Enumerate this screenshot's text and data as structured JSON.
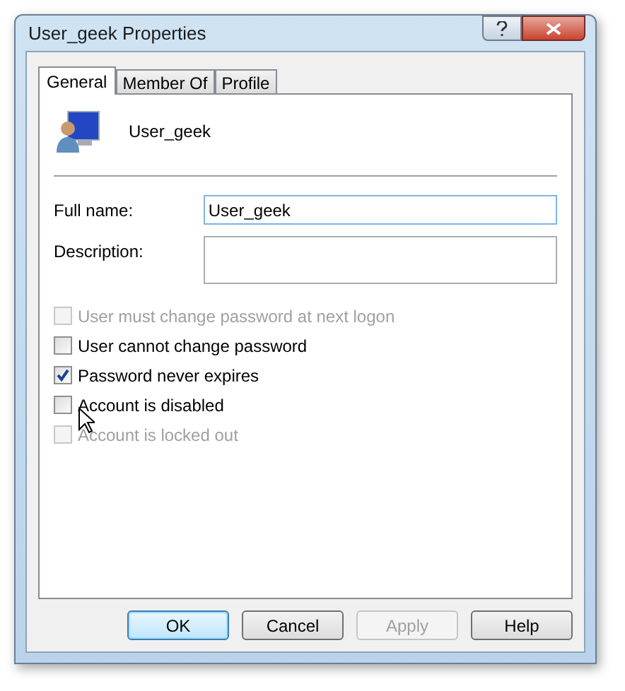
{
  "window": {
    "title": "User_geek Properties"
  },
  "tabs": [
    {
      "label": "General",
      "selected": true
    },
    {
      "label": "Member Of",
      "selected": false
    },
    {
      "label": "Profile",
      "selected": false
    }
  ],
  "user": {
    "name": "User_geek"
  },
  "fields": [
    {
      "label": "Full name:",
      "value": "User_geek",
      "kind": "line"
    },
    {
      "label": "Description:",
      "kind": "box"
    }
  ],
  "options": [
    {
      "label": "User must change password at next logon",
      "checked": false,
      "disabled": true
    },
    {
      "label": "User cannot change password",
      "checked": false,
      "disabled": false
    },
    {
      "label": "Password never expires",
      "checked": true,
      "disabled": false
    },
    {
      "label": "Account is disabled",
      "checked": false,
      "disabled": false
    },
    {
      "label": "Account is locked out",
      "checked": false,
      "disabled": true
    }
  ],
  "buttons": [
    {
      "label": "OK",
      "default": true,
      "disabled": false
    },
    {
      "label": "Cancel",
      "default": false,
      "disabled": false
    },
    {
      "label": "Apply",
      "default": false,
      "disabled": true
    },
    {
      "label": "Help",
      "default": false,
      "disabled": false
    }
  ]
}
